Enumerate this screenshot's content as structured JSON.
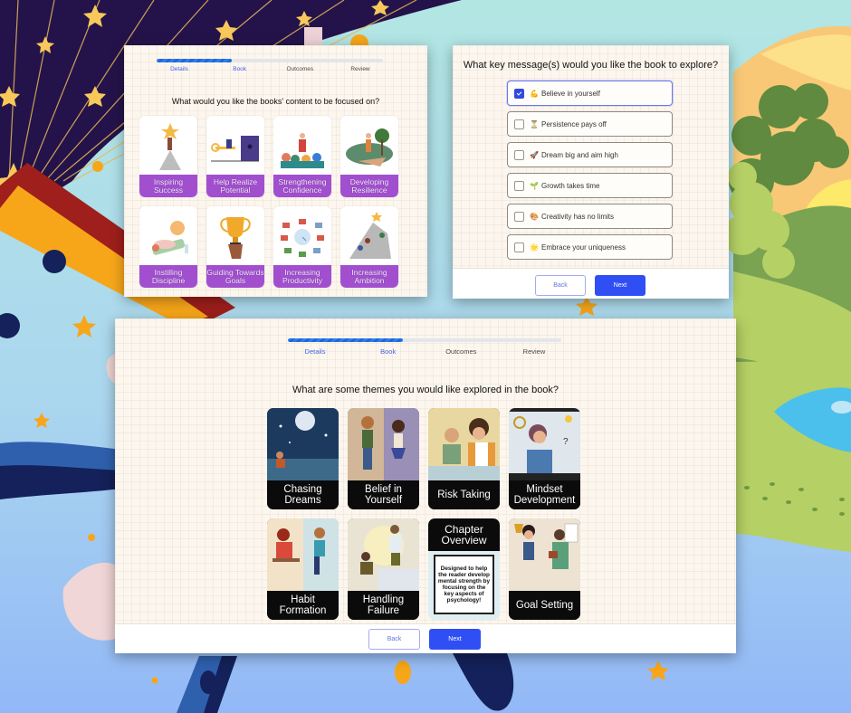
{
  "background": {
    "colors": {
      "night": "#24134a",
      "star": "#f8c95a",
      "teal": "#b2e6e3",
      "sky": "#93b8f7",
      "hill_green": "#7aa352",
      "light_green": "#b5d065",
      "tree_dark": "#5f8a3f",
      "sun": "#fde96a",
      "lake": "#4cc0ec",
      "navy": "#14215a",
      "blue": "#2f60ae",
      "orange": "#f7a61a",
      "red": "#9e1f1b"
    }
  },
  "accent": {
    "primary": "#2f4ff5",
    "purple_label": "#a24fcf",
    "step_active": "#4a62e6"
  },
  "stepper": {
    "progress_percent": 33,
    "steps": [
      {
        "label": "Details",
        "active": true
      },
      {
        "label": "Book",
        "active": true
      },
      {
        "label": "Outcomes",
        "active": false
      },
      {
        "label": "Review",
        "active": false
      }
    ]
  },
  "focus_panel": {
    "question": "What would you like the books' content to be focused on?",
    "cards": [
      {
        "label": "Inspiring Success",
        "icon": "star-summit-illustration"
      },
      {
        "label": "Help Realize Potential",
        "icon": "key-door-illustration"
      },
      {
        "label": "Strengthening Confidence",
        "icon": "speaker-crowd-illustration"
      },
      {
        "label": "Developing Resilience",
        "icon": "hiker-illustration"
      },
      {
        "label": "Instilling Discipline",
        "icon": "resting-workout-illustration"
      },
      {
        "label": "Guiding Towards Goals",
        "icon": "trophy-illustration"
      },
      {
        "label": "Increasing Productivity",
        "icon": "clock-tasks-illustration"
      },
      {
        "label": "Increasing Ambition",
        "icon": "climbing-mountain-illustration"
      }
    ]
  },
  "message_panel": {
    "question": "What key message(s) would you like the book to explore?",
    "options": [
      {
        "emoji": "💪",
        "label": "Believe in yourself",
        "checked": true
      },
      {
        "emoji": "⏳",
        "label": "Persistence pays off",
        "checked": false
      },
      {
        "emoji": "🚀",
        "label": "Dream big and aim high",
        "checked": false
      },
      {
        "emoji": "🌱",
        "label": "Growth takes time",
        "checked": false
      },
      {
        "emoji": "🎨",
        "label": "Creativity has no limits",
        "checked": false
      },
      {
        "emoji": "🌟",
        "label": "Embrace your uniqueness",
        "checked": false
      }
    ],
    "back_label": "Back",
    "next_label": "Next"
  },
  "themes_panel": {
    "question": "What are some themes you would like explored in the book?",
    "cards": [
      {
        "label": "Chasing Dreams",
        "art": "night-sky-dreamer-art"
      },
      {
        "label": "Belief in Yourself",
        "art": "confident-kids-art"
      },
      {
        "label": "Risk Taking",
        "art": "card-game-friends-art"
      },
      {
        "label": "Mindset Development",
        "art": "thinking-girl-gears-art"
      },
      {
        "label": "Habit Formation",
        "art": "study-and-exercise-art"
      },
      {
        "label": "Handling Failure",
        "art": "helping-hand-art"
      },
      {
        "label": "Chapter Overview",
        "body": "Designed to help the reader develop mental strength by focusing on the key aspects of psychology!",
        "overview": true
      },
      {
        "label": "Goal Setting",
        "art": "trophy-and-notes-art"
      }
    ],
    "back_label": "Back",
    "next_label": "Next"
  }
}
